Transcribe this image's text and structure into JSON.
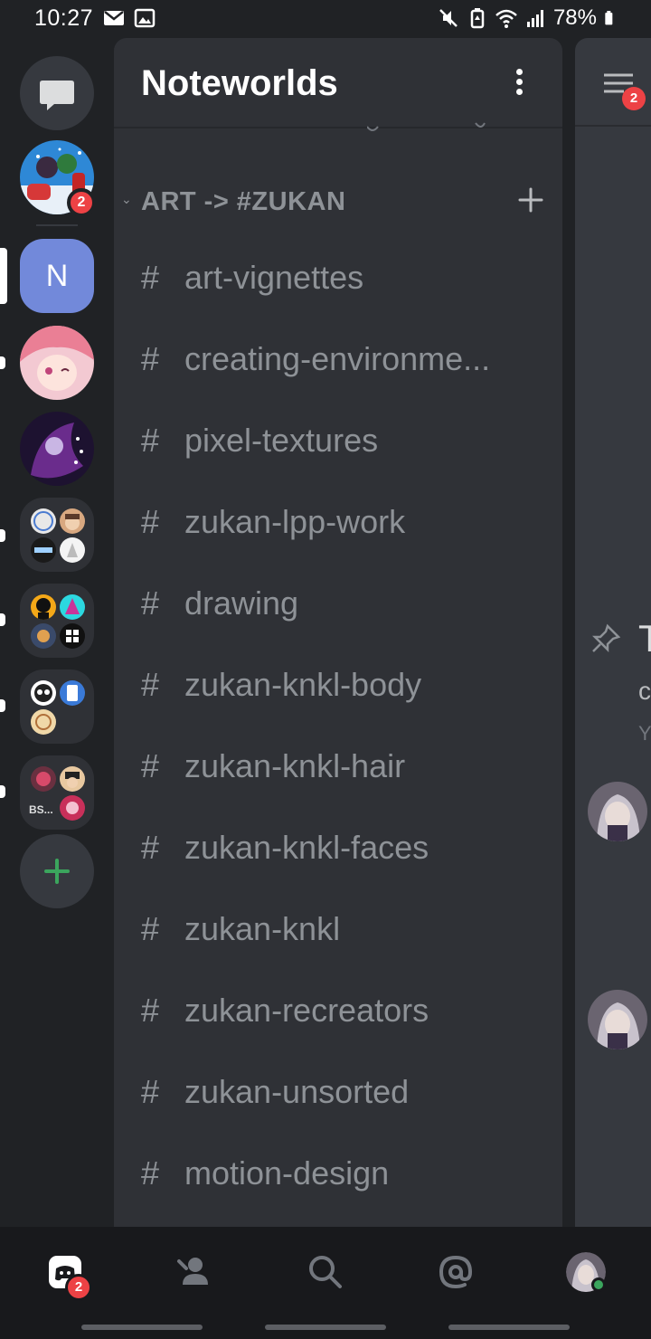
{
  "status_bar": {
    "time": "10:27",
    "battery": "78%",
    "icons": [
      "mail-icon",
      "image-icon",
      "mute-icon",
      "battery-saver-icon",
      "wifi-icon",
      "signal-icon",
      "battery-icon"
    ]
  },
  "rail": {
    "dm_icon": "chat-bubble-icon",
    "first_server_badge": "2",
    "active_server_initial": "N",
    "add_server_icon": "plus-icon",
    "folder_text": "BS..."
  },
  "server": {
    "name": "Noteworlds",
    "menu_icon": "kebab-icon"
  },
  "category": {
    "name": "ART -> #ZUKAN",
    "add_icon": "plus-icon"
  },
  "channels": [
    {
      "hash": "#",
      "name": "art-vignettes"
    },
    {
      "hash": "#",
      "name": "creating-environme..."
    },
    {
      "hash": "#",
      "name": "pixel-textures"
    },
    {
      "hash": "#",
      "name": "zukan-lpp-work"
    },
    {
      "hash": "#",
      "name": "drawing"
    },
    {
      "hash": "#",
      "name": "zukan-knkl-body"
    },
    {
      "hash": "#",
      "name": "zukan-knkl-hair"
    },
    {
      "hash": "#",
      "name": "zukan-knkl-faces"
    },
    {
      "hash": "#",
      "name": "zukan-knkl"
    },
    {
      "hash": "#",
      "name": "zukan-recreators"
    },
    {
      "hash": "#",
      "name": "zukan-unsorted"
    },
    {
      "hash": "#",
      "name": "motion-design"
    }
  ],
  "chat_peek": {
    "members_badge": "2",
    "t": "T",
    "o": "c",
    "y": "Y"
  },
  "bottom_nav": {
    "home_badge": "2",
    "items": [
      "home-icon",
      "friends-icon",
      "search-icon",
      "mentions-icon",
      "profile-avatar"
    ]
  },
  "colors": {
    "accent": "#7289da",
    "badge": "#ed4245",
    "online": "#3ba55d"
  }
}
